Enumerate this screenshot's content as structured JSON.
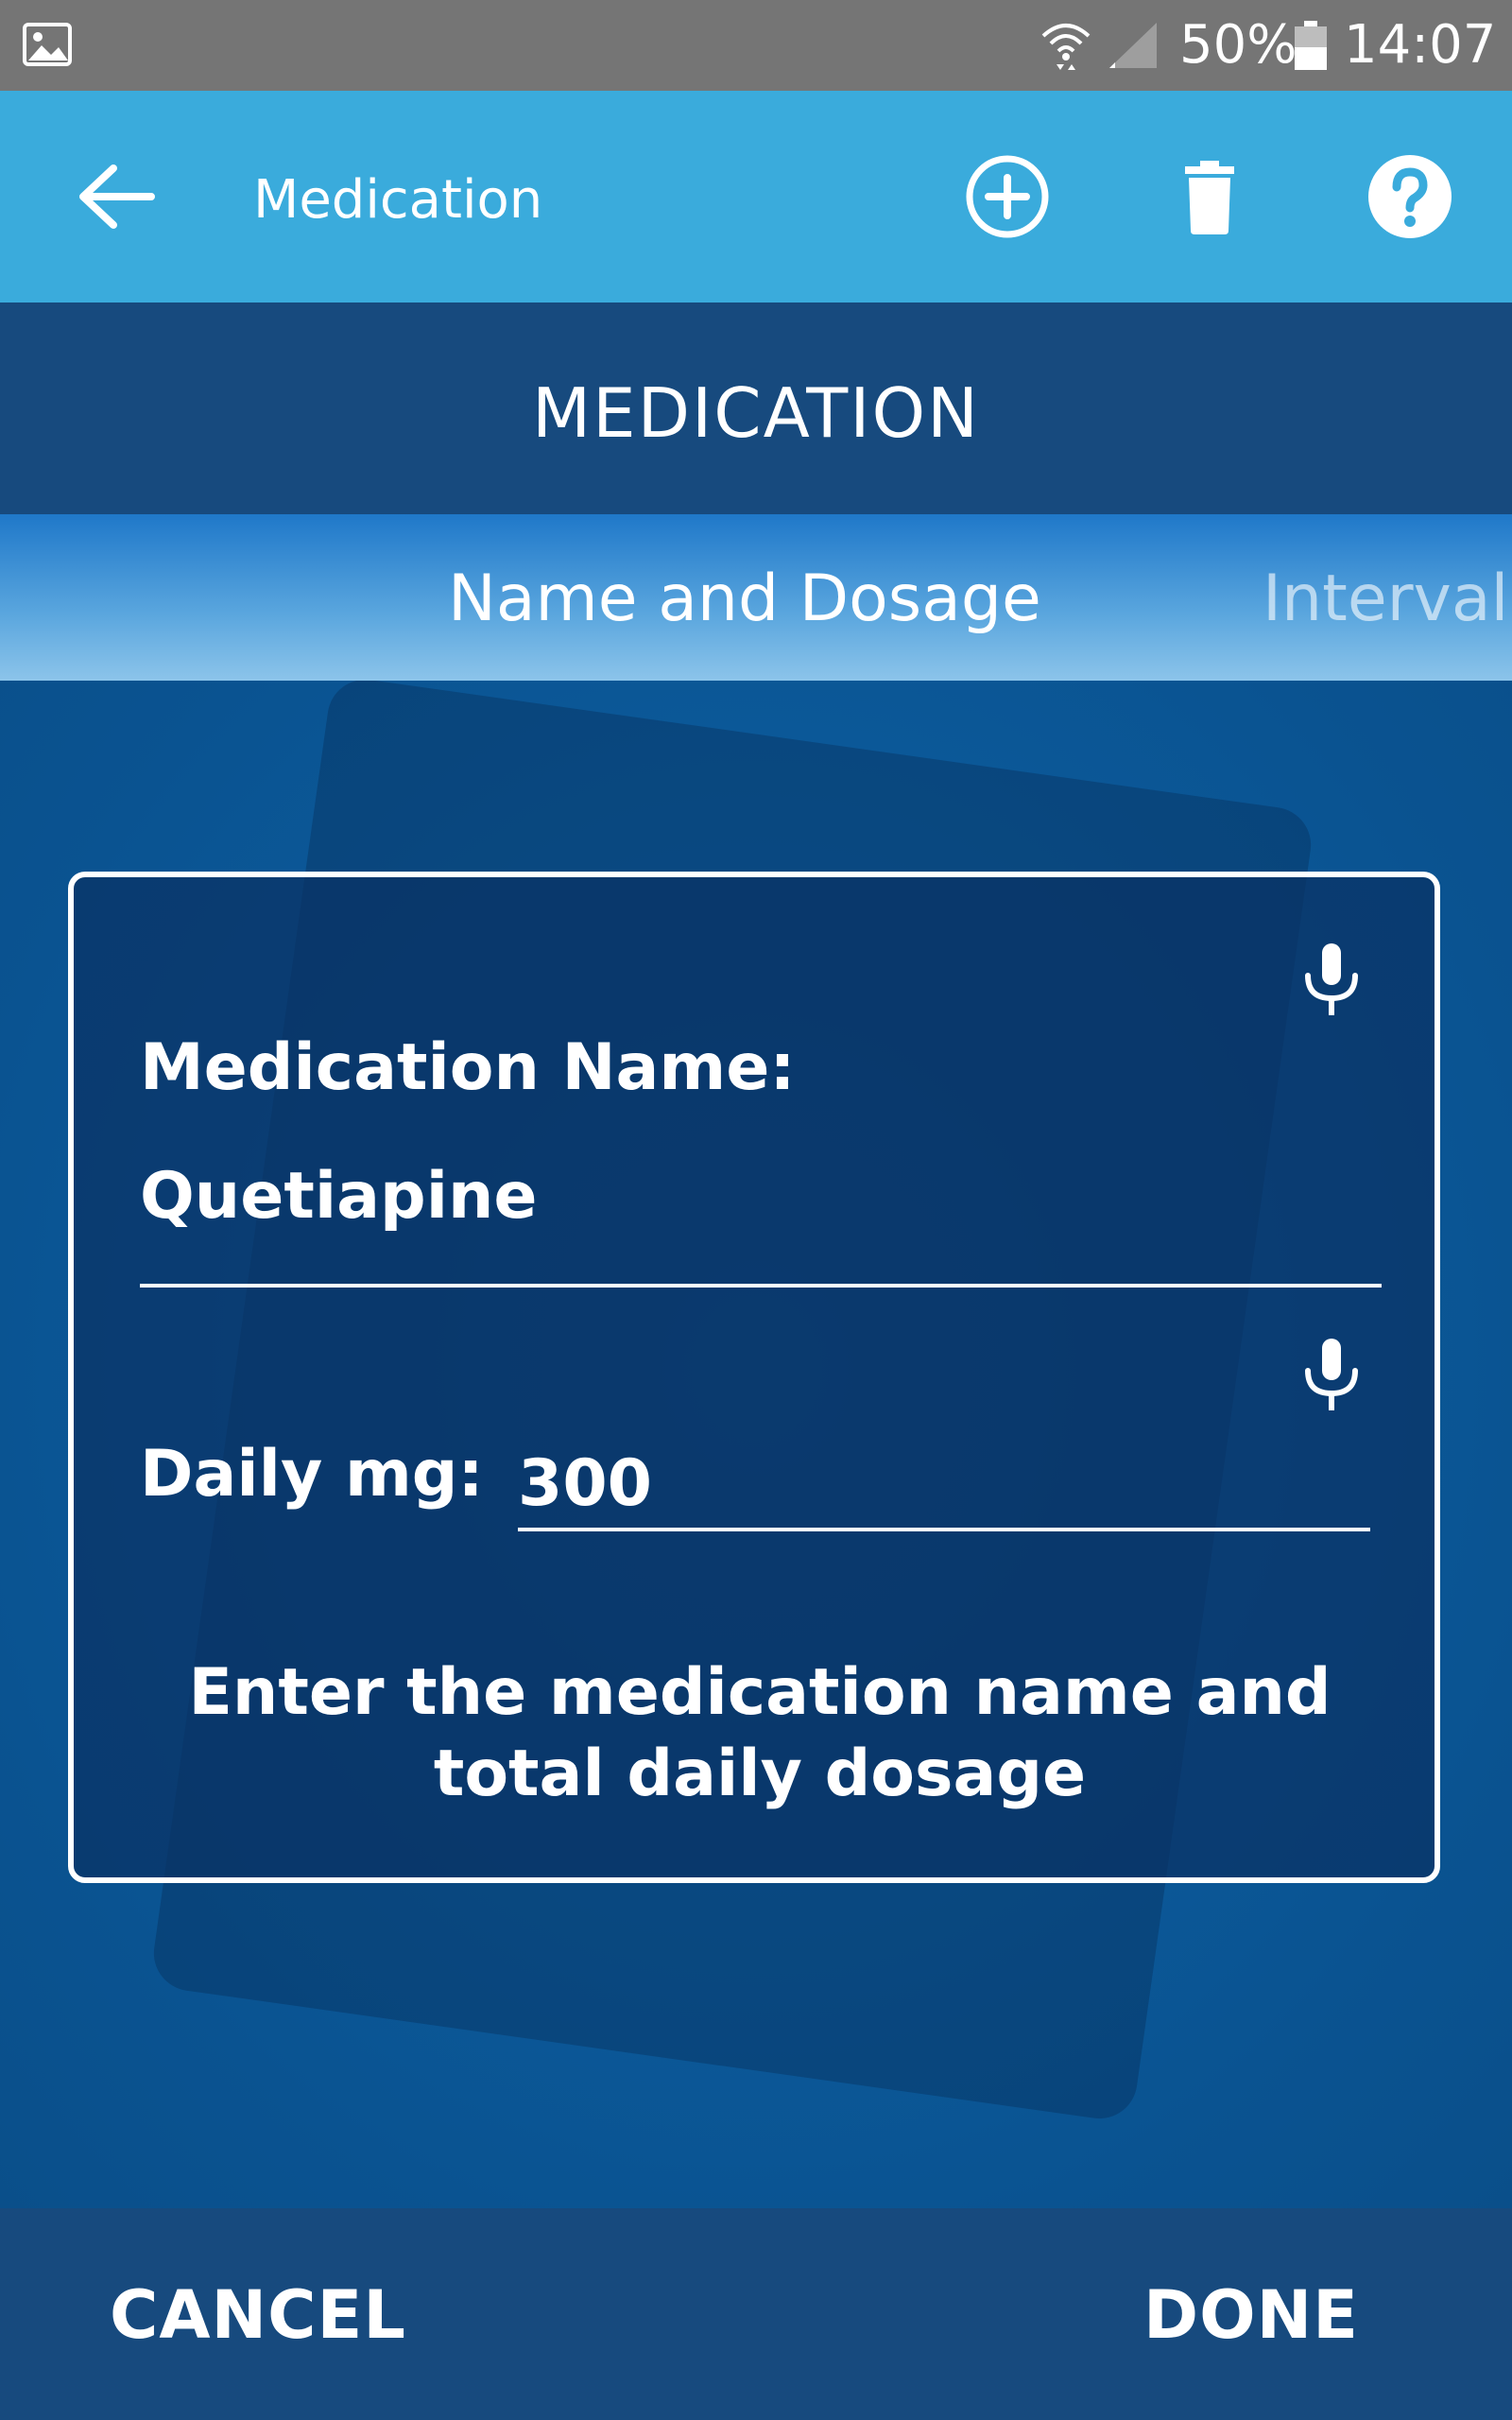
{
  "status_bar": {
    "battery_percent": "50%",
    "time": "14:07",
    "icons": [
      "gallery-icon",
      "wifi-icon",
      "signal-icon",
      "battery-icon"
    ]
  },
  "app_bar": {
    "title": "Medication",
    "actions": [
      "back-arrow-icon",
      "add-circle-icon",
      "trash-icon",
      "help-icon"
    ]
  },
  "header": {
    "heading": "MEDICATION"
  },
  "tabs": [
    {
      "label": "Name and Dosage",
      "active": true
    },
    {
      "label": "Interval",
      "active": false
    }
  ],
  "form": {
    "name_label": "Medication Name:",
    "name_value": "Quetiapine",
    "mg_label": "Daily mg:",
    "mg_value": "300",
    "hint": "Enter the medication name and total daily dosage"
  },
  "footer": {
    "cancel_label": "CANCEL",
    "done_label": "DONE"
  },
  "colors": {
    "app_bar": "#3aabdc",
    "header": "#174a7e",
    "status_bar": "#757575"
  }
}
